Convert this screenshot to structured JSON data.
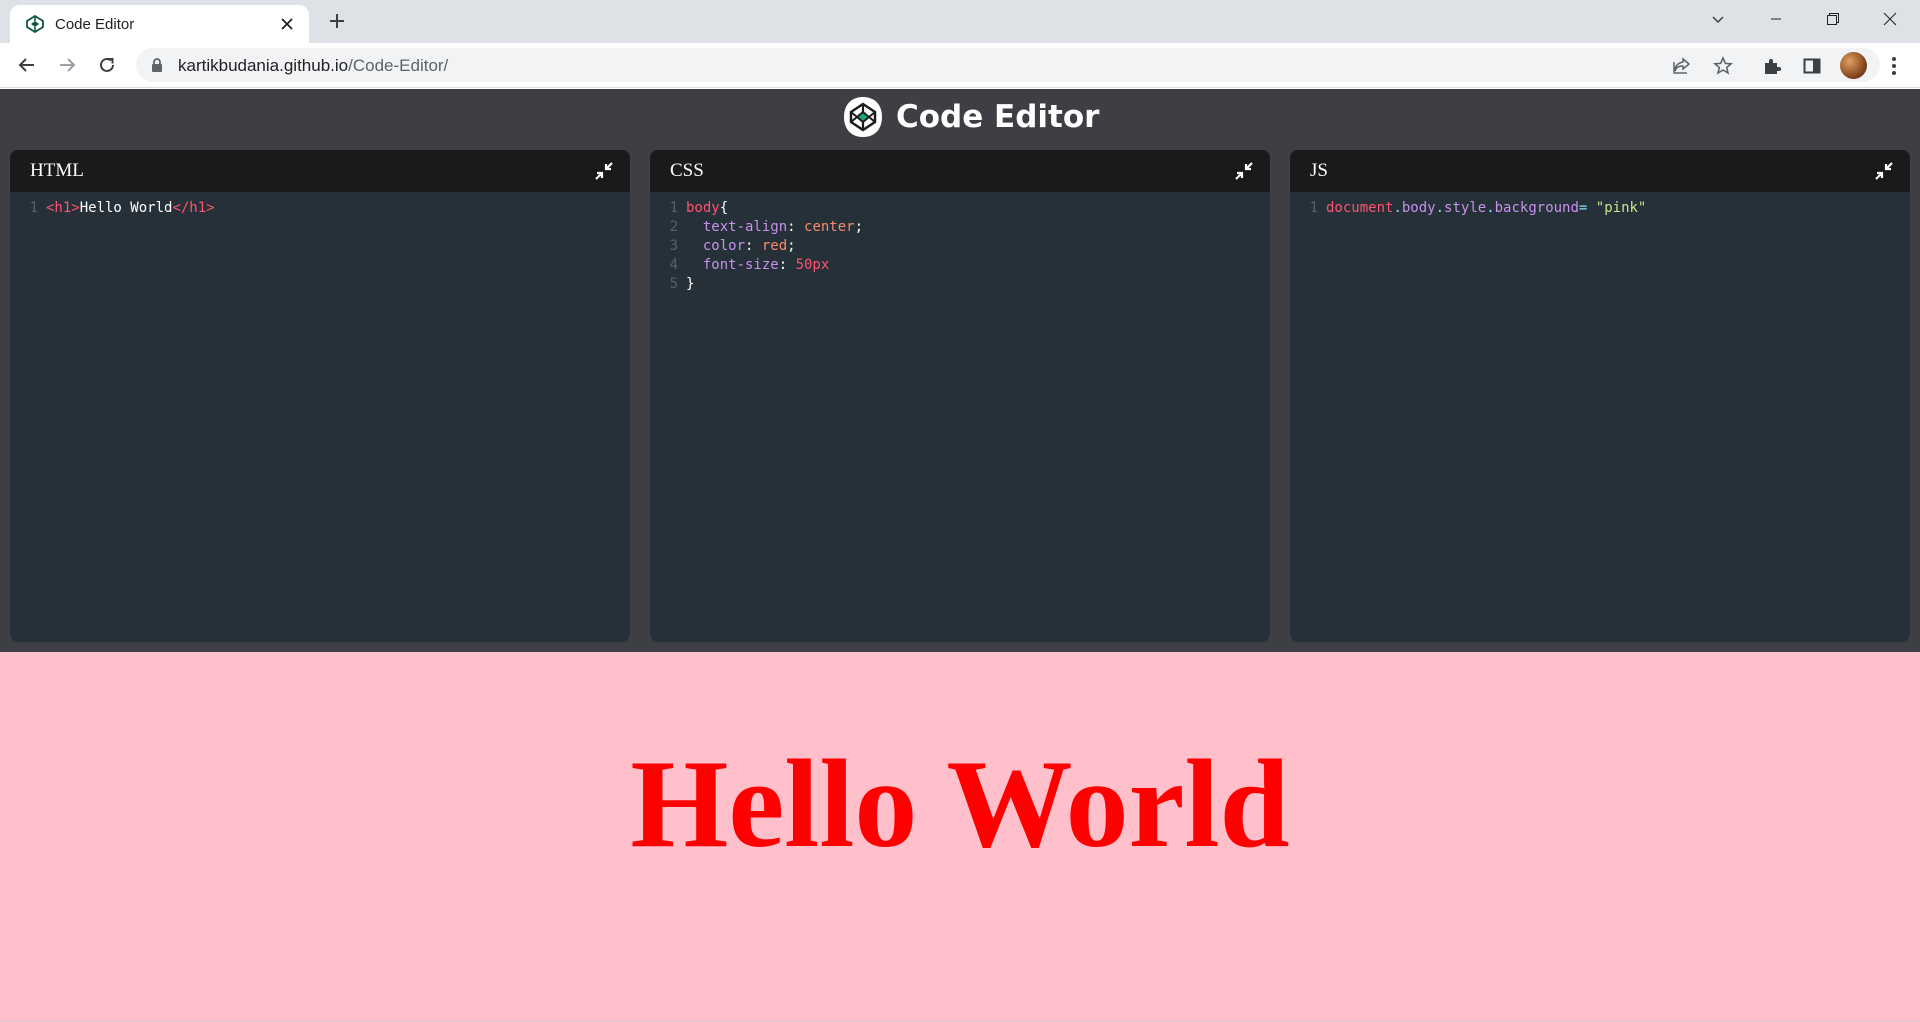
{
  "browser": {
    "tab_title": "Code Editor",
    "url_host": "kartikbudania.github.io",
    "url_path": "/Code-Editor/"
  },
  "app": {
    "title": "Code Editor"
  },
  "panels": [
    {
      "title": "HTML",
      "lines": [
        [
          {
            "t": "<h1>",
            "c": "#ff5370"
          },
          {
            "t": "Hello World",
            "c": "#ffffff"
          },
          {
            "t": "</h1>",
            "c": "#ff5370"
          }
        ]
      ]
    },
    {
      "title": "CSS",
      "lines": [
        [
          {
            "t": "body",
            "c": "#ff5370"
          },
          {
            "t": "{",
            "c": "#ffffff"
          }
        ],
        [
          {
            "t": "  text-align",
            "c": "#c792ea"
          },
          {
            "t": ": ",
            "c": "#ffffff"
          },
          {
            "t": "center",
            "c": "#f78c6c"
          },
          {
            "t": ";",
            "c": "#ffffff"
          }
        ],
        [
          {
            "t": "  color",
            "c": "#c792ea"
          },
          {
            "t": ": ",
            "c": "#ffffff"
          },
          {
            "t": "red",
            "c": "#f78c6c"
          },
          {
            "t": ";",
            "c": "#ffffff"
          }
        ],
        [
          {
            "t": "  font-size",
            "c": "#c792ea"
          },
          {
            "t": ": ",
            "c": "#ffffff"
          },
          {
            "t": "50px",
            "c": "#ff5370"
          }
        ],
        [
          {
            "t": "}",
            "c": "#ffffff"
          }
        ]
      ]
    },
    {
      "title": "JS",
      "lines": [
        [
          {
            "t": "document",
            "c": "#ff5370"
          },
          {
            "t": ".",
            "c": "#89ddff"
          },
          {
            "t": "body",
            "c": "#c792ea"
          },
          {
            "t": ".",
            "c": "#89ddff"
          },
          {
            "t": "style",
            "c": "#c792ea"
          },
          {
            "t": ".",
            "c": "#89ddff"
          },
          {
            "t": "background",
            "c": "#c792ea"
          },
          {
            "t": "= ",
            "c": "#89ddff"
          },
          {
            "t": "\"pink\"",
            "c": "#c3e88d"
          }
        ]
      ]
    }
  ],
  "preview": {
    "heading": "Hello World",
    "background": "#ffc0cb",
    "heading_color": "#ff0000"
  },
  "icons": {
    "tab_close": "close-icon",
    "new_tab": "plus-icon",
    "panel_toggle": "minimize-arrows-icon"
  }
}
